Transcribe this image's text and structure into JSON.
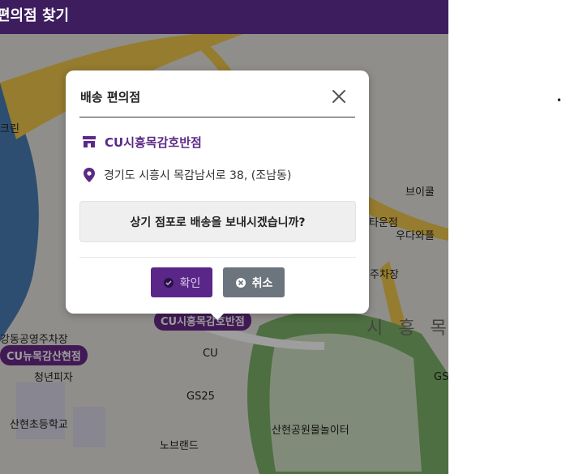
{
  "header": {
    "title": "편의점 찾기"
  },
  "map": {
    "labels": [
      "크린",
      "브이쿨",
      "타운점",
      "우다와플",
      "주차장",
      "강동공영주차장",
      "청년피자",
      "CU",
      "GS25",
      "산현초등학교",
      "노브랜드",
      "산현공원물놀이터",
      "GS"
    ],
    "region_label": "시 흥 목",
    "pins": [
      "CU뉴목감산현점",
      "CU시흥목감호반점"
    ]
  },
  "modal": {
    "title": "배송 편의점",
    "store_name": "CU시흥목감호반점",
    "address": "경기도 시흥시 목감남서로 38, (조남동)",
    "question": "상기 점포로 배송을 보내시겠습니까?",
    "confirm_label": "확인",
    "cancel_label": "취소"
  },
  "side": {
    "bullet": "•"
  },
  "colors": {
    "accent": "#5a2789",
    "header": "#3d1d5e",
    "cancel": "#6c757d"
  },
  "icons": {
    "store": "store-icon",
    "location": "location-pin-icon",
    "close": "close-icon",
    "confirm": "check-circle-icon",
    "cancel": "x-circle-icon"
  }
}
